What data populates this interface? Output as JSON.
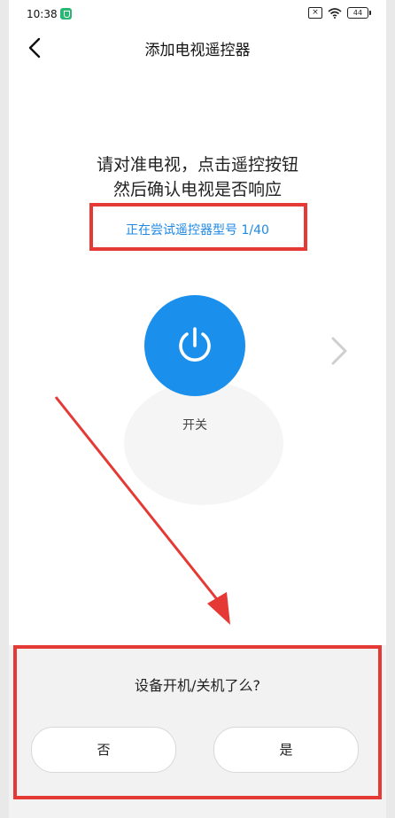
{
  "status_bar": {
    "time": "10:38",
    "battery": "44"
  },
  "header": {
    "title": "添加电视遥控器"
  },
  "instruction": {
    "line1": "请对准电视，点击遥控按钮",
    "line2": "然后确认电视是否响应"
  },
  "model_status": "正在尝试遥控器型号 1/40",
  "power": {
    "label": "开关"
  },
  "dialog": {
    "question": "设备开机/关机了么?",
    "no_label": "否",
    "yes_label": "是"
  },
  "colors": {
    "accent": "#1a8fec",
    "highlight": "#e53935",
    "link": "#1e88e5"
  },
  "icons": [
    "back-icon",
    "power-icon",
    "chevron-right-icon",
    "wifi-icon",
    "battery-icon",
    "shield-icon",
    "sim-x-icon"
  ]
}
